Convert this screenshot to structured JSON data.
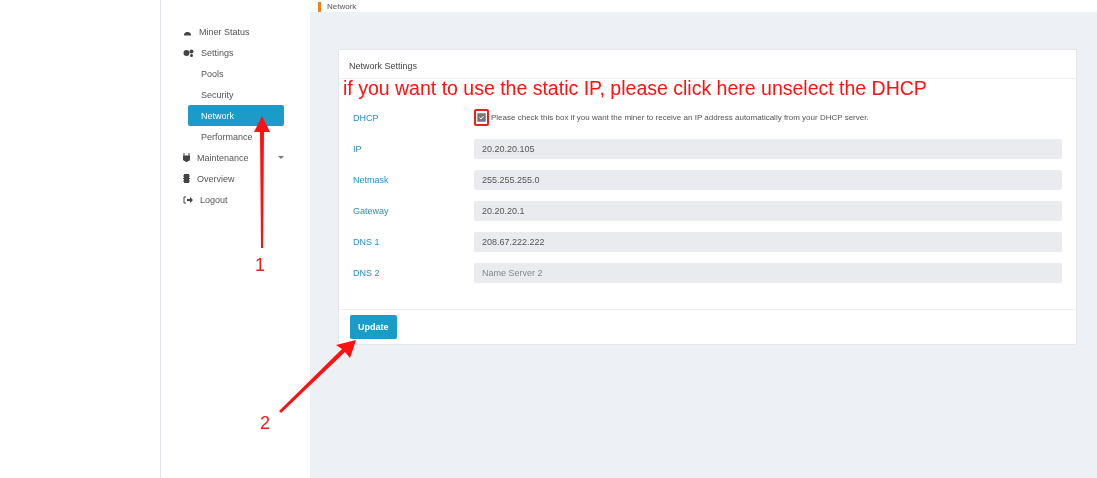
{
  "breadcrumb": "Network",
  "sidebar": {
    "items": [
      {
        "label": "Miner Status",
        "selected": false
      },
      {
        "label": "Settings",
        "selected": false,
        "expanded": true,
        "children": [
          {
            "label": "Pools",
            "selected": false
          },
          {
            "label": "Security",
            "selected": false
          },
          {
            "label": "Network",
            "selected": true
          },
          {
            "label": "Performance",
            "selected": false
          }
        ]
      },
      {
        "label": "Maintenance",
        "selected": false,
        "expanded": false
      },
      {
        "label": "Overview",
        "selected": false
      },
      {
        "label": "Logout",
        "selected": false
      }
    ]
  },
  "card": {
    "title": "Network Settings",
    "dhcp": {
      "label": "DHCP",
      "checked": true,
      "text": "Please check this box if you want the miner to receive an IP address automatically from your DHCP server."
    },
    "fields": [
      {
        "label": "IP",
        "value": "20.20.20.105"
      },
      {
        "label": "Netmask",
        "value": "255.255.255.0"
      },
      {
        "label": "Gateway",
        "value": "20.20.20.1"
      },
      {
        "label": "DNS 1",
        "value": "208.67.222.222"
      },
      {
        "label": "DNS 2",
        "placeholder": "Name Server 2"
      }
    ],
    "button": "Update"
  },
  "annotations": {
    "note": "if you want to use the static IP, please click here unselect the DHCP",
    "step_1": "1",
    "step_2": "2"
  }
}
